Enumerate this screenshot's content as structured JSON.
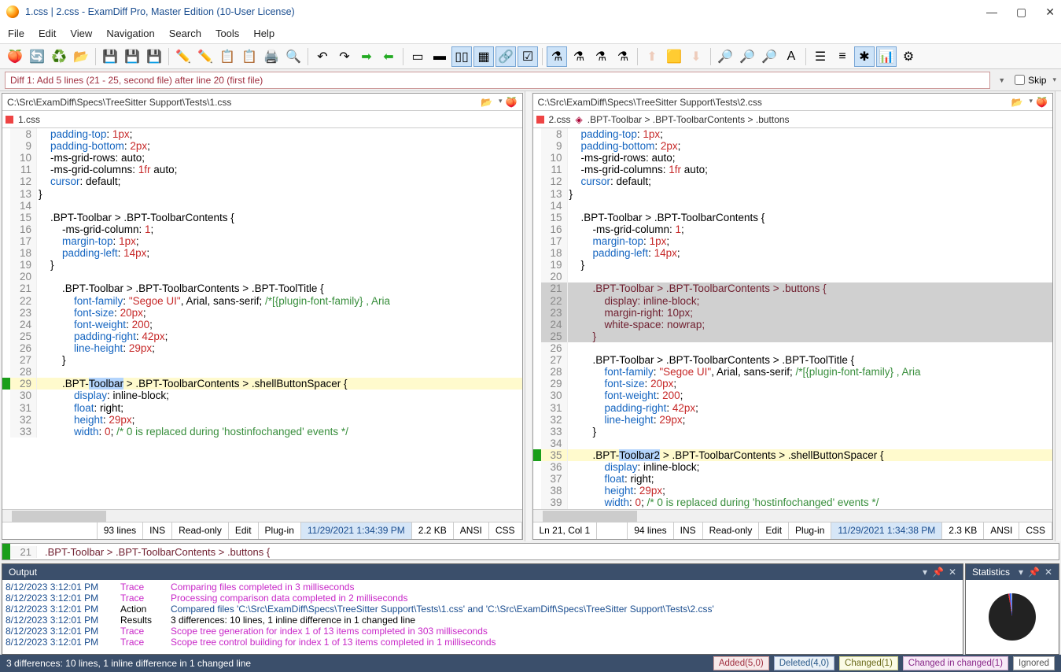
{
  "title": "1.css  |  2.css - ExamDiff Pro, Master Edition (10-User License)",
  "menu": [
    "File",
    "Edit",
    "View",
    "Navigation",
    "Search",
    "Tools",
    "Help"
  ],
  "diffmsg": "Diff 1: Add 5 lines (21 - 25, second file) after line 20 (first file)",
  "skip_label": "Skip",
  "left": {
    "path": "C:\\Src\\ExamDiff\\Specs\\TreeSitter Support\\Tests\\1.css",
    "tab": "1.css",
    "status": {
      "lines": "93 lines",
      "ins": "INS",
      "ro": "Read-only",
      "edit": "Edit",
      "plugin": "Plug-in",
      "date": "11/29/2021 1:34:39 PM",
      "size": "2.2 KB",
      "enc": "ANSI",
      "lang": "CSS"
    }
  },
  "right": {
    "path": "C:\\Src\\ExamDiff\\Specs\\TreeSitter Support\\Tests\\2.css",
    "tab": "2.css",
    "breadcrumb": ".BPT-Toolbar > .BPT-ToolbarContents > .buttons",
    "status": {
      "pos": "Ln 21, Col 1",
      "lines": "94 lines",
      "ins": "INS",
      "ro": "Read-only",
      "edit": "Edit",
      "plugin": "Plug-in",
      "date": "11/29/2021 1:34:38 PM",
      "size": "2.3 KB",
      "enc": "ANSI",
      "lang": "CSS"
    }
  },
  "bottomline": {
    "num": "21",
    "text": "      .BPT-Toolbar > .BPT-ToolbarContents > .buttons {"
  },
  "log": [
    {
      "ts": "8/12/2023 3:12:01 PM",
      "kind": "Trace",
      "msg": "Comparing files completed in 3 milliseconds",
      "cls": "tr"
    },
    {
      "ts": "8/12/2023 3:12:01 PM",
      "kind": "Trace",
      "msg": "Processing comparison data completed in 2 milliseconds",
      "cls": "tr"
    },
    {
      "ts": "8/12/2023 3:12:01 PM",
      "kind": "Action",
      "msg": "Compared files 'C:\\Src\\ExamDiff\\Specs\\TreeSitter Support\\Tests\\1.css' and 'C:\\Src\\ExamDiff\\Specs\\TreeSitter Support\\Tests\\2.css'",
      "cls": "ac"
    },
    {
      "ts": "8/12/2023 3:12:01 PM",
      "kind": "Results",
      "msg": "3 differences: 10 lines, 1 inline difference in 1 changed line",
      "cls": ""
    },
    {
      "ts": "8/12/2023 3:12:01 PM",
      "kind": "Trace",
      "msg": "Scope tree generation for index 1 of 13 items completed in 303 milliseconds",
      "cls": "tr"
    },
    {
      "ts": "8/12/2023 3:12:01 PM",
      "kind": "Trace",
      "msg": "Scope tree control building for index 1 of 13 items completed in 1 milliseconds",
      "cls": "tr"
    }
  ],
  "footer_msg": "3 differences: 10 lines, 1 inline difference in 1 changed line",
  "tags": {
    "added": "Added(5,0)",
    "deleted": "Deleted(4,0)",
    "changed": "Changed(1)",
    "changedin": "Changed in changed(1)",
    "ignored": "Ignored"
  },
  "panel": {
    "output": "Output",
    "stats": "Statistics"
  }
}
